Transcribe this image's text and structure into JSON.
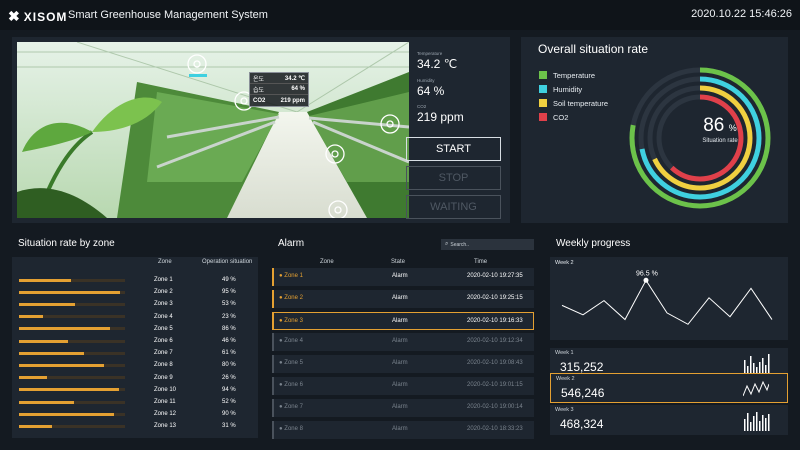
{
  "header": {
    "logo": "XISOM",
    "title": "Smart Greenhouse Management System",
    "datetime": "2020.10.22  15:46:26"
  },
  "camera": {
    "overlay": [
      {
        "label": "온도",
        "value": "34.2 ℃"
      },
      {
        "label": "습도",
        "value": "64 %"
      },
      {
        "label": "CO2",
        "value": "219 ppm"
      }
    ]
  },
  "sensors": [
    {
      "label": "Temperature",
      "value": "34.2 ℃"
    },
    {
      "label": "Humidity",
      "value": "64 %"
    },
    {
      "label": "CO2",
      "value": "219 ppm"
    }
  ],
  "controls": {
    "start": "START",
    "stop": "STOP",
    "waiting": "WAITING"
  },
  "overall": {
    "title": "Overall situation rate",
    "legend": [
      {
        "name": "Temperature",
        "color": "#6cc24a",
        "rate": 0.78
      },
      {
        "name": "Humidity",
        "color": "#3fd0e0",
        "rate": 0.72
      },
      {
        "name": "Soil temperature",
        "color": "#f0d040",
        "rate": 0.68
      },
      {
        "name": "CO2",
        "color": "#e0404a",
        "rate": 0.62
      }
    ],
    "value": "86",
    "unit": "%",
    "label": "Situation rate"
  },
  "zones": {
    "title": "Situation rate by zone",
    "col_zone": "Zone",
    "col_situation": "Operation situation",
    "rows": [
      {
        "name": "Zone 1",
        "pct": "49 %",
        "value": 49
      },
      {
        "name": "Zone 2",
        "pct": "95 %",
        "value": 95
      },
      {
        "name": "Zone 3",
        "pct": "53 %",
        "value": 53
      },
      {
        "name": "Zone 4",
        "pct": "23 %",
        "value": 23
      },
      {
        "name": "Zone 5",
        "pct": "86 %",
        "value": 86
      },
      {
        "name": "Zone 6",
        "pct": "46 %",
        "value": 46
      },
      {
        "name": "Zone 7",
        "pct": "61 %",
        "value": 61
      },
      {
        "name": "Zone 8",
        "pct": "80 %",
        "value": 80
      },
      {
        "name": "Zone 9",
        "pct": "26 %",
        "value": 26
      },
      {
        "name": "Zone 10",
        "pct": "94 %",
        "value": 94
      },
      {
        "name": "Zone 11",
        "pct": "52 %",
        "value": 52
      },
      {
        "name": "Zone 12",
        "pct": "90 %",
        "value": 90
      },
      {
        "name": "Zone 13",
        "pct": "31 %",
        "value": 31
      }
    ]
  },
  "alarm": {
    "title": "Alarm",
    "search_placeholder": "Search..",
    "col_zone": "Zone",
    "col_state": "State",
    "col_time": "Time",
    "rows": [
      {
        "zone": "Zone 1",
        "state": "Alarm",
        "time": "2020-02-10  19:27:35",
        "active": true
      },
      {
        "zone": "Zone 2",
        "state": "Alarm",
        "time": "2020-02-10  19:25:15",
        "active": true
      },
      {
        "zone": "Zone 3",
        "state": "Alarm",
        "time": "2020-02-10  19:16:33",
        "active": true
      },
      {
        "zone": "Zone 4",
        "state": "Alarm",
        "time": "2020-02-10  19:12:34",
        "active": false
      },
      {
        "zone": "Zone 5",
        "state": "Alarm",
        "time": "2020-02-10  19:08:43",
        "active": false
      },
      {
        "zone": "Zone 6",
        "state": "Alarm",
        "time": "2020-02-10  19:01:15",
        "active": false
      },
      {
        "zone": "Zone 7",
        "state": "Alarm",
        "time": "2020-02-10  19:00:14",
        "active": false
      },
      {
        "zone": "Zone 8",
        "state": "Alarm",
        "time": "2020-02-10  18:33:23",
        "active": false
      }
    ]
  },
  "weekly": {
    "title": "Weekly progress",
    "chart_label": "Week 2",
    "peak_label": "96.5  %",
    "line_values": [
      70,
      60,
      75,
      55,
      96.5,
      62,
      50,
      78,
      58,
      88,
      55
    ],
    "cards": [
      {
        "label": "Week 1",
        "value": "315,252"
      },
      {
        "label": "Week 2",
        "value": "546,246"
      },
      {
        "label": "Week 3",
        "value": "468,324"
      }
    ]
  }
}
